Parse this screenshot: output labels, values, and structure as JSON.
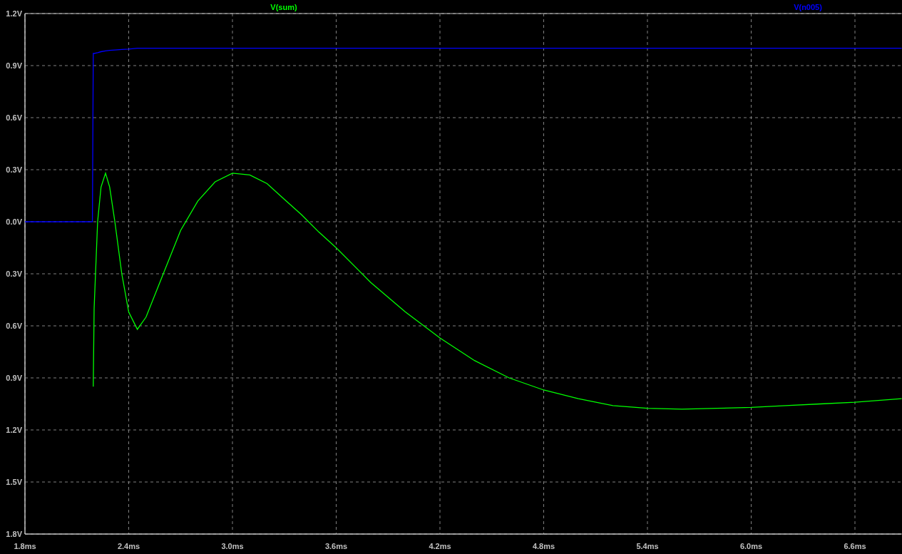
{
  "plot": {
    "chart_data": {
      "type": "line",
      "x": [
        1.8,
        2.0,
        2.19,
        2.195,
        2.2,
        2.22,
        2.24,
        2.266,
        2.29,
        2.32,
        2.36,
        2.4,
        2.45,
        2.5,
        2.6,
        2.7,
        2.8,
        2.9,
        3.0,
        3.1,
        3.2,
        3.3,
        3.4,
        3.5,
        3.6,
        3.8,
        4.0,
        4.2,
        4.4,
        4.6,
        4.8,
        5.0,
        5.2,
        5.4,
        5.6,
        5.8,
        6.0,
        6.2,
        6.4,
        6.6,
        6.87
      ],
      "series": [
        {
          "name": "V(sum)",
          "color": "#00ff00",
          "values": [
            null,
            null,
            null,
            -0.95,
            -0.5,
            0.0,
            0.2,
            0.28,
            0.2,
            0.0,
            -0.3,
            -0.52,
            -0.62,
            -0.55,
            -0.3,
            -0.05,
            0.12,
            0.23,
            0.28,
            0.27,
            0.22,
            0.13,
            0.04,
            -0.06,
            -0.15,
            -0.35,
            -0.52,
            -0.67,
            -0.8,
            -0.9,
            -0.97,
            -1.02,
            -1.06,
            -1.075,
            -1.08,
            -1.075,
            -1.07,
            -1.06,
            -1.05,
            -1.04,
            -1.02
          ]
        },
        {
          "name": "V(n005)",
          "color": "#0000ff",
          "values": [
            0,
            0,
            0,
            0.97,
            0.97,
            0.975,
            0.98,
            0.985,
            0.988,
            0.99,
            0.993,
            0.995,
            1.0,
            1.0,
            1.0,
            1.0,
            1.0,
            1.0,
            1.0,
            1.0,
            1.0,
            1.0,
            1.0,
            1.0,
            1.0,
            1.0,
            1.0,
            1.0,
            1.0,
            1.0,
            1.0,
            1.0,
            1.0,
            1.0,
            1.0,
            1.0,
            1.0,
            1.0,
            1.0,
            1.0,
            1.0
          ]
        }
      ],
      "grid": true,
      "xlim": [
        1.8,
        6.87
      ],
      "ylim": [
        -1.8,
        1.2
      ],
      "xticks": [
        {
          "value": 1.8,
          "label": "1.8ms"
        },
        {
          "value": 2.4,
          "label": "2.4ms"
        },
        {
          "value": 3.0,
          "label": "3.0ms"
        },
        {
          "value": 3.6,
          "label": "3.6ms"
        },
        {
          "value": 4.2,
          "label": "4.2ms"
        },
        {
          "value": 4.8,
          "label": "4.8ms"
        },
        {
          "value": 5.4,
          "label": "5.4ms"
        },
        {
          "value": 6.0,
          "label": "6.0ms"
        },
        {
          "value": 6.6,
          "label": "6.6ms"
        }
      ],
      "yticks": [
        {
          "value": 1.2,
          "label": "1.2V"
        },
        {
          "value": 0.9,
          "label": "0.9V"
        },
        {
          "value": 0.6,
          "label": "0.6V"
        },
        {
          "value": 0.3,
          "label": "0.3V"
        },
        {
          "value": 0.0,
          "label": "0.0V"
        },
        {
          "value": -0.3,
          "label": "0.3V"
        },
        {
          "value": -0.6,
          "label": "0.6V"
        },
        {
          "value": -0.9,
          "label": "0.9V"
        },
        {
          "value": -1.2,
          "label": "1.2V"
        },
        {
          "value": -1.5,
          "label": "1.5V"
        },
        {
          "value": -1.8,
          "label": "1.8V"
        }
      ]
    }
  }
}
